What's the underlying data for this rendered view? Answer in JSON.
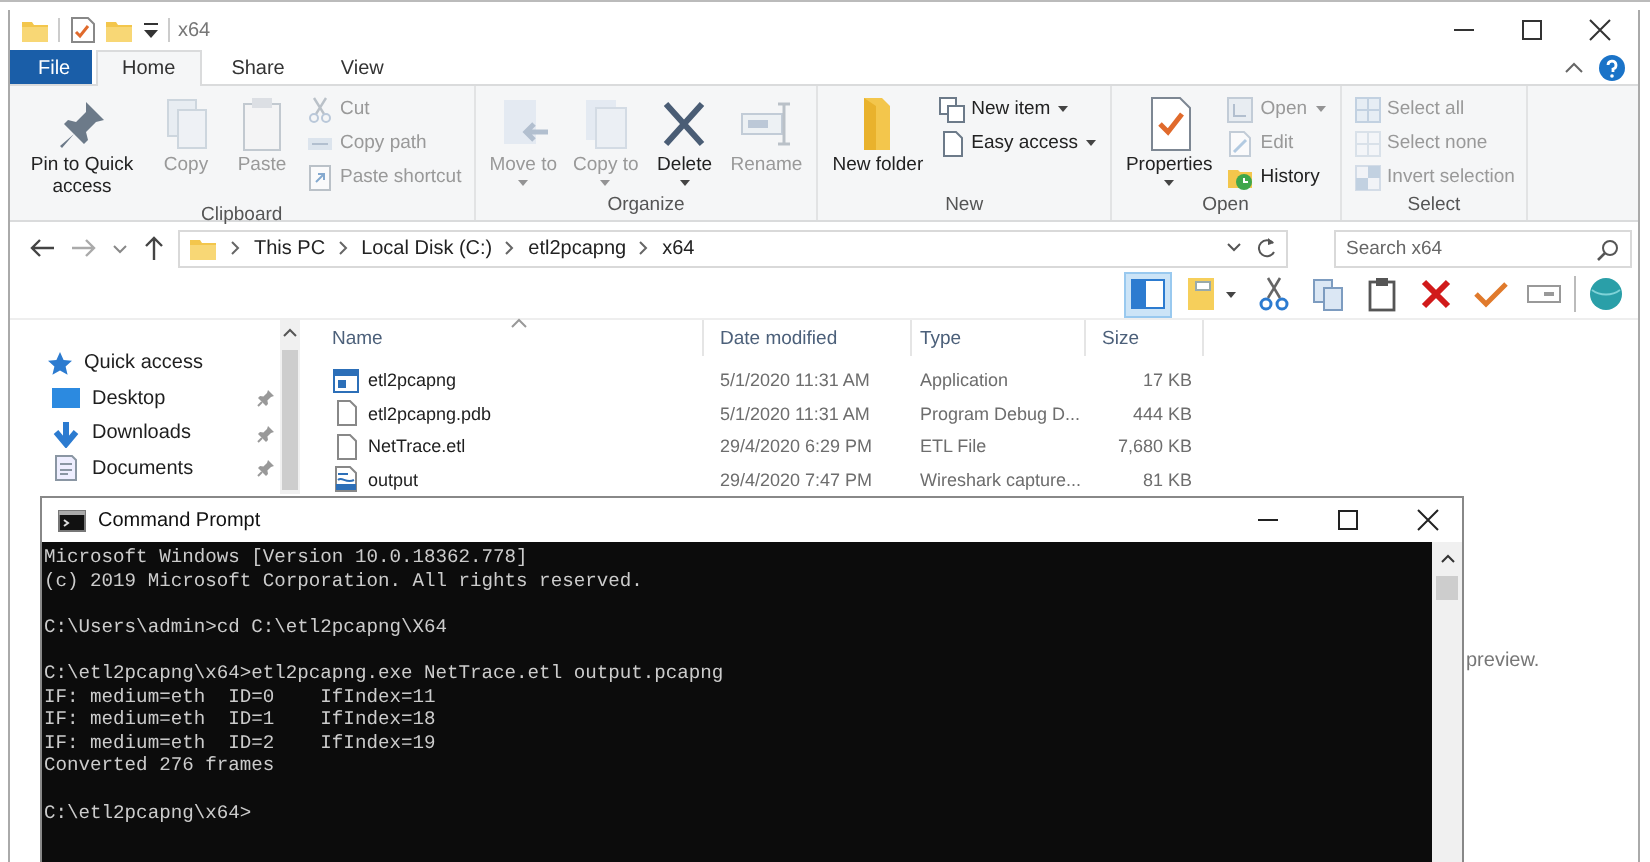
{
  "explorer": {
    "title": "x64",
    "ribbon_tabs": [
      {
        "label": "File",
        "kind": "file",
        "selected": false
      },
      {
        "label": "Home",
        "kind": "tab",
        "selected": true
      },
      {
        "label": "Share",
        "kind": "tab",
        "selected": false
      },
      {
        "label": "View",
        "kind": "tab",
        "selected": false
      }
    ],
    "ribbon_groups": [
      {
        "label": "Clipboard",
        "commands": [
          {
            "label": "Pin to Quick access",
            "kind": "large",
            "disabled": false,
            "dropdown": false
          },
          {
            "label": "Copy",
            "kind": "large",
            "disabled": true,
            "dropdown": false
          },
          {
            "label": "Paste",
            "kind": "large",
            "disabled": true,
            "dropdown": false
          },
          {
            "label": "Cut",
            "kind": "small",
            "disabled": true,
            "dropdown": false
          },
          {
            "label": "Copy path",
            "kind": "small",
            "disabled": true,
            "dropdown": false
          },
          {
            "label": "Paste shortcut",
            "kind": "small",
            "disabled": true,
            "dropdown": false
          }
        ]
      },
      {
        "label": "Organize",
        "commands": [
          {
            "label": "Move to",
            "kind": "large",
            "disabled": true,
            "dropdown": true
          },
          {
            "label": "Copy to",
            "kind": "large",
            "disabled": true,
            "dropdown": true
          },
          {
            "label": "Delete",
            "kind": "large",
            "disabled": false,
            "dropdown": true
          },
          {
            "label": "Rename",
            "kind": "large",
            "disabled": true,
            "dropdown": false
          }
        ]
      },
      {
        "label": "New",
        "commands": [
          {
            "label": "New folder",
            "kind": "large",
            "disabled": false,
            "dropdown": false
          },
          {
            "label": "New item",
            "kind": "small",
            "disabled": false,
            "dropdown": true
          },
          {
            "label": "Easy access",
            "kind": "small",
            "disabled": false,
            "dropdown": true
          }
        ]
      },
      {
        "label": "Open",
        "commands": [
          {
            "label": "Properties",
            "kind": "large",
            "disabled": false,
            "dropdown": true
          },
          {
            "label": "Open",
            "kind": "small",
            "disabled": true,
            "dropdown": true
          },
          {
            "label": "Edit",
            "kind": "small",
            "disabled": true,
            "dropdown": false
          },
          {
            "label": "History",
            "kind": "small",
            "disabled": false,
            "dropdown": false
          }
        ]
      },
      {
        "label": "Select",
        "commands": [
          {
            "label": "Select all",
            "kind": "small",
            "disabled": true,
            "dropdown": false
          },
          {
            "label": "Select none",
            "kind": "small",
            "disabled": true,
            "dropdown": false
          },
          {
            "label": "Invert selection",
            "kind": "small",
            "disabled": true,
            "dropdown": false
          }
        ]
      }
    ],
    "address": [
      "This PC",
      "Local Disk (C:)",
      "etl2pcapng",
      "x64"
    ],
    "search": {
      "placeholder": "Search x64"
    },
    "toolbar": [
      {
        "selected": true
      },
      {
        "selected": false
      },
      {
        "selected": false
      },
      {
        "selected": false
      },
      {
        "selected": false
      },
      {
        "selected": false
      },
      {
        "selected": false
      },
      {
        "selected": false
      },
      {
        "selected": false
      }
    ],
    "nav": [
      {
        "label": "Quick access",
        "pinned": false
      },
      {
        "label": "Desktop",
        "pinned": true
      },
      {
        "label": "Downloads",
        "pinned": true
      },
      {
        "label": "Documents",
        "pinned": true
      }
    ],
    "columns": [
      {
        "label": "Name",
        "sorted": true
      },
      {
        "label": "Date modified",
        "sorted": false
      },
      {
        "label": "Type",
        "sorted": false
      },
      {
        "label": "Size",
        "sorted": false
      }
    ],
    "rows": [
      {
        "cells": [
          "etl2pcapng",
          "5/1/2020 11:31 AM",
          "Application",
          "17 KB"
        ],
        "kind": "app"
      },
      {
        "cells": [
          "etl2pcapng.pdb",
          "5/1/2020 11:31 AM",
          "Program Debug D...",
          "444 KB"
        ],
        "kind": "file"
      },
      {
        "cells": [
          "NetTrace.etl",
          "29/4/2020 6:29 PM",
          "ETL File",
          "7,680 KB"
        ],
        "kind": "file"
      },
      {
        "cells": [
          "output",
          "29/4/2020 7:47 PM",
          "Wireshark capture...",
          "81 KB"
        ],
        "kind": "capture"
      }
    ],
    "preview_text": "preview."
  },
  "cmd": {
    "title": "Command Prompt",
    "blocks": [
      [
        "Microsoft Windows [Version 10.0.18362.778]",
        "(c) 2019 Microsoft Corporation. All rights reserved."
      ],
      [
        "C:\\Users\\admin>cd C:\\etl2pcapng\\X64"
      ],
      [
        "C:\\etl2pcapng\\x64>etl2pcapng.exe NetTrace.etl output.pcapng",
        "IF: medium=eth  ID=0    IfIndex=11",
        "IF: medium=eth  ID=1    IfIndex=18",
        "IF: medium=eth  ID=2    IfIndex=19",
        "Converted 276 frames"
      ],
      [
        "C:\\etl2pcapng\\x64>"
      ]
    ]
  }
}
